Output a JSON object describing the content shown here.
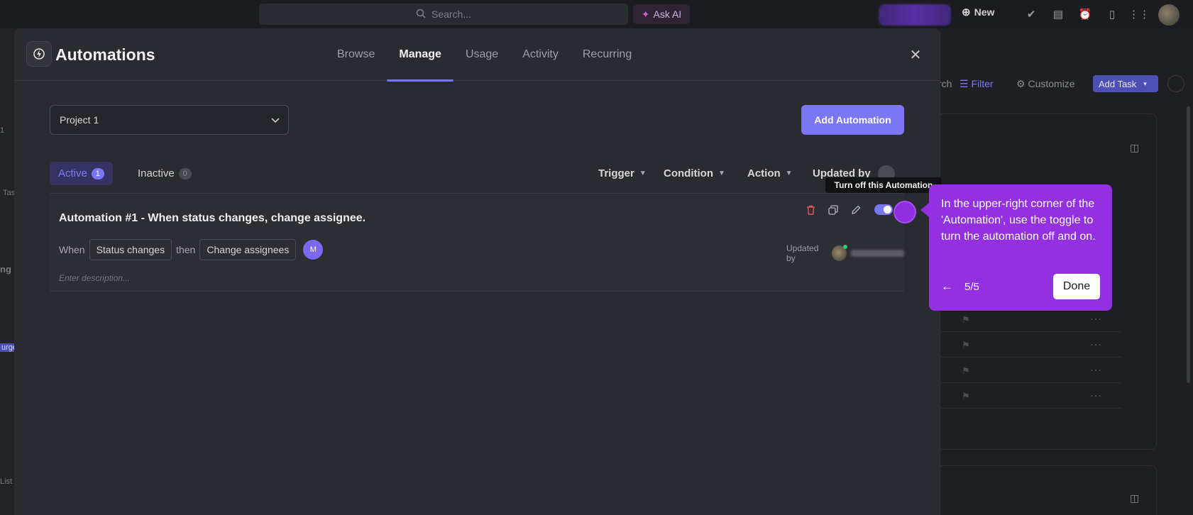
{
  "topbar": {
    "search_placeholder": "Search...",
    "ask_ai": "Ask AI",
    "new_label": "New"
  },
  "background": {
    "search_partial": "rch",
    "filter": "Filter",
    "customize": "Customize",
    "add_task": "Add Task",
    "left_labels": [
      "1",
      "Tas",
      "ng",
      "urge",
      "List"
    ]
  },
  "modal": {
    "title": "Automations",
    "tabs": [
      "Browse",
      "Manage",
      "Usage",
      "Activity",
      "Recurring"
    ],
    "active_tab": "Manage",
    "project": "Project 1",
    "add_button": "Add Automation",
    "status_tabs": {
      "active_label": "Active",
      "active_count": "1",
      "inactive_label": "Inactive",
      "inactive_count": "0"
    },
    "filters": [
      "Trigger",
      "Condition",
      "Action",
      "Updated by"
    ],
    "automation": {
      "title": "Automation #1 - When status changes, change assignee.",
      "when": "When",
      "trigger_chip": "Status changes",
      "then": "then",
      "action_chip": "Change assignees",
      "assignee_initial": "M",
      "updated_by": "Updated by",
      "description_placeholder": "Enter description...",
      "enabled": true
    }
  },
  "tooltip": "Turn off this Automation",
  "guide": {
    "text": "In the upper-right corner of the 'Automation', use the toggle to turn the automation off and on.",
    "step": "5/5",
    "done": "Done"
  },
  "colors": {
    "accent": "#7b76f2",
    "guide": "#9331e0"
  }
}
